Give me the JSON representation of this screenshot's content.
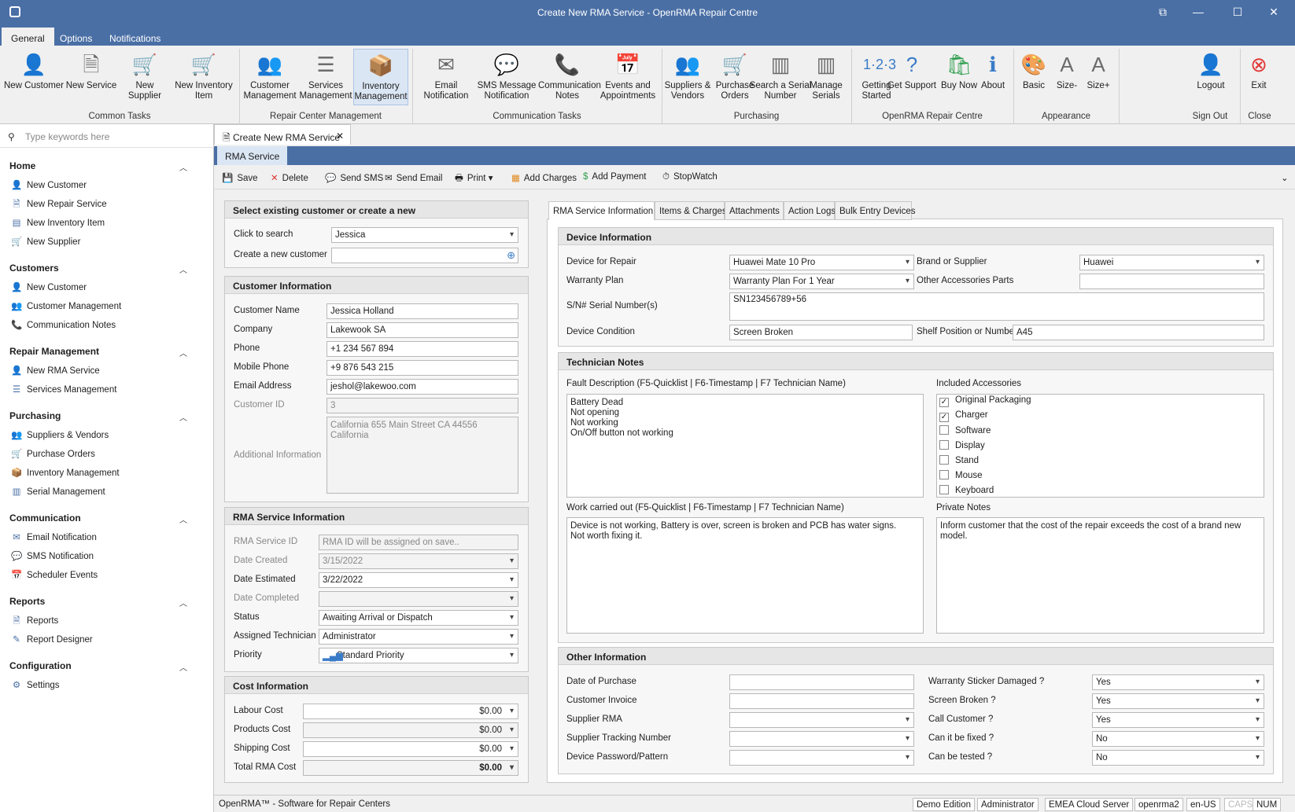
{
  "window": {
    "title": "Create New RMA Service - OpenRMA Repair Centre"
  },
  "menu": {
    "tabs": [
      "General",
      "Options",
      "Notifications"
    ]
  },
  "ribbon": {
    "buttons": [
      {
        "label": "New Customer",
        "icon": "person-icon"
      },
      {
        "label": "New Service",
        "icon": "document-icon"
      },
      {
        "label": "New Supplier",
        "icon": "cart-icon"
      },
      {
        "label": "New Inventory Item",
        "icon": "cart-add-icon"
      },
      {
        "label": "Customer Management",
        "icon": "people-icon"
      },
      {
        "label": "Services Management",
        "icon": "list-icon"
      },
      {
        "label": "Inventory Management",
        "icon": "box-icon"
      },
      {
        "label": "Email Notification",
        "icon": "envelope-icon"
      },
      {
        "label": "SMS Message Notification",
        "icon": "chat-icon"
      },
      {
        "label": "Communication Notes",
        "icon": "phone-icon"
      },
      {
        "label": "Events and Appointments",
        "icon": "calendar-icon"
      },
      {
        "label": "Suppliers & Vendors",
        "icon": "people-icon"
      },
      {
        "label": "Purchase Orders",
        "icon": "cart-icon"
      },
      {
        "label": "Search a Serial Number",
        "icon": "barcode-icon"
      },
      {
        "label": "Manage Serials",
        "icon": "barcode-icon"
      },
      {
        "label": "Getting Started",
        "icon": "numbers-icon"
      },
      {
        "label": "Get Support",
        "icon": "help-icon"
      },
      {
        "label": "Buy Now",
        "icon": "buy-icon"
      },
      {
        "label": "About",
        "icon": "info-icon"
      },
      {
        "label": "Basic",
        "icon": "palette-icon"
      },
      {
        "label": "Size-",
        "icon": "font-smaller-icon"
      },
      {
        "label": "Size+",
        "icon": "font-larger-icon"
      },
      {
        "label": "Logout",
        "icon": "logout-icon"
      },
      {
        "label": "Exit",
        "icon": "close-circle-icon"
      }
    ],
    "groups": [
      "Common Tasks",
      "Repair Center Management",
      "Communication Tasks",
      "Purchasing",
      "OpenRMA Repair Centre",
      "Appearance",
      "Sign Out",
      "Close"
    ]
  },
  "sidebar": {
    "search_placeholder": "Type keywords here",
    "sections": [
      {
        "title": "Home",
        "items": [
          "New Customer",
          "New Repair Service",
          "New Inventory Item",
          "New Supplier"
        ]
      },
      {
        "title": "Customers",
        "items": [
          "New Customer",
          "Customer Management",
          "Communication Notes"
        ]
      },
      {
        "title": "Repair Management",
        "items": [
          "New RMA Service",
          "Services Management"
        ]
      },
      {
        "title": "Purchasing",
        "items": [
          "Suppliers & Vendors",
          "Purchase Orders",
          "Inventory Management",
          "Serial Management"
        ]
      },
      {
        "title": "Communication",
        "items": [
          "Email Notification",
          "SMS Notification",
          "Scheduler Events"
        ]
      },
      {
        "title": "Reports",
        "items": [
          "Reports",
          "Report Designer"
        ]
      },
      {
        "title": "Configuration",
        "items": [
          "Settings"
        ]
      }
    ]
  },
  "doc_tab": {
    "label": "Create New RMA Service",
    "sub": "RMA Service"
  },
  "toolbar": {
    "save": "Save",
    "delete": "Delete",
    "send_sms": "Send SMS",
    "send_email": "Send Email",
    "print": "Print",
    "add_charges": "Add Charges",
    "add_payment": "Add Payment",
    "stopwatch": "StopWatch"
  },
  "select_customer": {
    "title": "Select existing customer or create a new",
    "click_label": "Click to search",
    "click_value": "Jessica",
    "create_label": "Create a new customer"
  },
  "customer_info": {
    "title": "Customer Information",
    "fields": [
      {
        "label": "Customer Name",
        "value": "Jessica Holland"
      },
      {
        "label": "Company",
        "value": "Lakewook SA"
      },
      {
        "label": "Phone",
        "value": "+1 234 567 894"
      },
      {
        "label": "Mobile Phone",
        "value": "+9 876 543 215"
      },
      {
        "label": "Email Address",
        "value": "jeshol@lakewoo.com"
      },
      {
        "label": "Customer ID",
        "value": "3"
      }
    ],
    "additional_label": "Additional Information",
    "additional_value": "California 655 Main Street CA 44556 California"
  },
  "rma_info": {
    "title": "RMA Service Information",
    "fields": [
      {
        "label": "RMA Service ID",
        "value": "RMA ID will be assigned on save.."
      },
      {
        "label": "Date Created",
        "value": "3/15/2022"
      },
      {
        "label": "Date Estimated",
        "value": "3/22/2022"
      },
      {
        "label": "Date Completed",
        "value": ""
      },
      {
        "label": "Status",
        "value": "Awaiting Arrival or Dispatch"
      },
      {
        "label": "Assigned Technician",
        "value": "Administrator"
      },
      {
        "label": "Priority",
        "value": "Standard Priority"
      }
    ]
  },
  "cost_info": {
    "title": "Cost Information",
    "fields": [
      {
        "label": "Labour Cost",
        "value": "$0.00"
      },
      {
        "label": "Products Cost",
        "value": "$0.00"
      },
      {
        "label": "Shipping Cost",
        "value": "$0.00"
      },
      {
        "label": "Total RMA Cost",
        "value": "$0.00"
      }
    ]
  },
  "inner_tabs": [
    "RMA Service Information",
    "Items & Charges",
    "Attachments",
    "Action Logs",
    "Bulk Entry Devices"
  ],
  "device_info": {
    "title": "Device Information",
    "device_label": "Device for Repair",
    "device_value": "Huawei Mate 10 Pro",
    "brand_label": "Brand or Supplier",
    "brand_value": "Huawei",
    "warranty_label": "Warranty Plan",
    "warranty_value": "Warranty Plan For 1 Year",
    "accessories_label": "Other Accessories Parts",
    "accessories_value": "",
    "serial_label": "S/N# Serial Number(s)",
    "serial_value": "SN123456789+56",
    "condition_label": "Device Condition",
    "condition_value": "Screen Broken",
    "shelf_label": "Shelf Position or Number",
    "shelf_value": "A45"
  },
  "tech_notes": {
    "title": "Technician Notes",
    "fault_label": "Fault Description (F5-Quicklist | F6-Timestamp | F7 Technician Name)",
    "fault_value": "Battery Dead\nNot opening\nNot working\nOn/Off button not working",
    "included_label": "Included Accessories",
    "accessories": [
      {
        "label": "Original Packaging",
        "checked": true
      },
      {
        "label": "Charger",
        "checked": true
      },
      {
        "label": "Software",
        "checked": false
      },
      {
        "label": "Display",
        "checked": false
      },
      {
        "label": "Stand",
        "checked": false
      },
      {
        "label": "Mouse",
        "checked": false
      },
      {
        "label": "Keyboard",
        "checked": false
      }
    ],
    "work_label": "Work carried out (F5-Quicklist | F6-Timestamp | F7 Technician Name)",
    "work_value": "Device is not working, Battery is over, screen is broken and PCB has water signs.\nNot worth fixing it.",
    "private_label": "Private Notes",
    "private_value": "Inform customer that the cost of the repair exceeds the cost of a brand new model."
  },
  "other_info": {
    "title": "Other Information",
    "left": [
      {
        "label": "Date of Purchase",
        "value": ""
      },
      {
        "label": "Customer Invoice",
        "value": ""
      },
      {
        "label": "Supplier RMA",
        "value": ""
      },
      {
        "label": "Supplier Tracking Number",
        "value": ""
      },
      {
        "label": "Device Password/Pattern",
        "value": ""
      }
    ],
    "right": [
      {
        "label": "Warranty Sticker Damaged ?",
        "value": "Yes"
      },
      {
        "label": "Screen Broken ?",
        "value": "Yes"
      },
      {
        "label": "Call Customer ?",
        "value": "Yes"
      },
      {
        "label": "Can it be fixed ?",
        "value": "No"
      },
      {
        "label": "Can be tested ?",
        "value": "No"
      }
    ]
  },
  "status_bar": {
    "app": "OpenRMA™ - Software for Repair Centers",
    "edition": "Demo Edition",
    "user": "Administrator",
    "server": "EMEA Cloud Server",
    "db": "openrma2",
    "locale": "en-US",
    "caps": "CAPS",
    "num": "NUM"
  }
}
